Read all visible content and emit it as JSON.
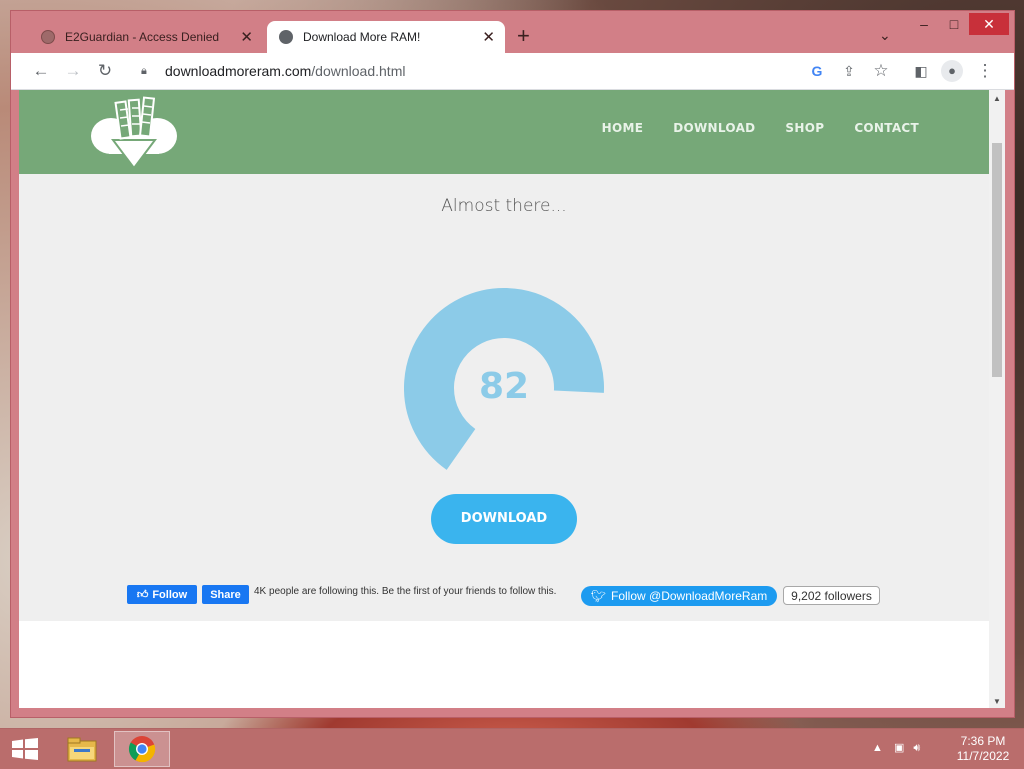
{
  "browser": {
    "tabs": [
      {
        "title": "E2Guardian - Access Denied",
        "active": false
      },
      {
        "title": "Download More RAM!",
        "active": true
      }
    ],
    "address": {
      "host": "downloadmoreram.com",
      "path": "/download.html"
    }
  },
  "site": {
    "nav": [
      "HOME",
      "DOWNLOAD",
      "SHOP",
      "CONTACT"
    ],
    "status_text": "Almost there...",
    "progress": {
      "value": 82,
      "max": 100
    },
    "download_label": "DOWNLOAD",
    "social": {
      "fb_follow": "Follow",
      "fb_share": "Share",
      "fb_text": "4K people are following this. Be the first of your friends to follow this.",
      "twitter_follow": "Follow @DownloadMoreRam",
      "twitter_followers": "9,202 followers"
    },
    "colors": {
      "header": "#76a878",
      "gauge": "#8ccbe8",
      "button": "#3ab4ee"
    }
  },
  "taskbar": {
    "time": "7:36 PM",
    "date": "11/7/2022"
  }
}
